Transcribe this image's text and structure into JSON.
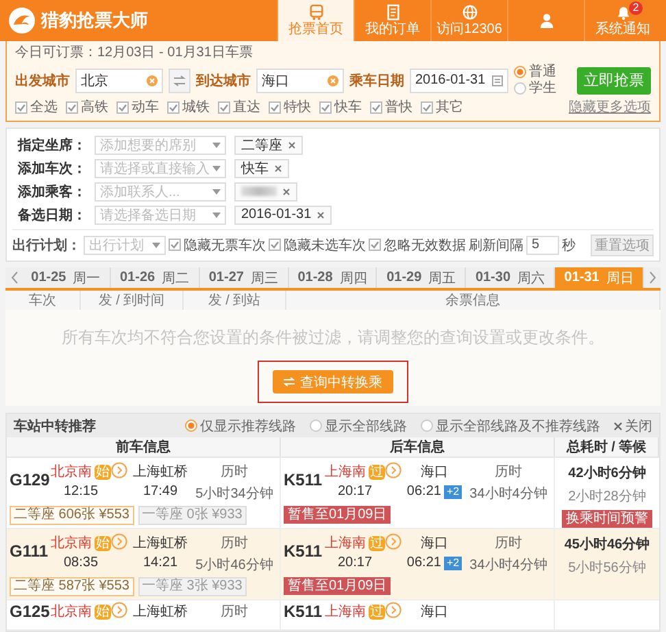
{
  "app": {
    "name": "猎豹抢票大师"
  },
  "nav": [
    {
      "label": "抢票首页",
      "selected": true
    },
    {
      "label": "我的订单",
      "selected": false
    },
    {
      "label": "访问12306",
      "selected": false
    },
    {
      "selected": false
    },
    {
      "label": "系统通知",
      "badge": "2",
      "selected": false
    }
  ],
  "search": {
    "notice": "今日可订票：12月03日 - 01月31日车票",
    "from_label": "出发城市",
    "from": "北京",
    "to_label": "到达城市",
    "to": "海口",
    "date_label": "乘车日期",
    "date": "2016-01-31",
    "ticket_types": [
      {
        "label": "普通",
        "selected": true
      },
      {
        "label": "学生",
        "selected": false
      }
    ],
    "submit": "立即抢票",
    "train_types": [
      {
        "label": "全选",
        "checked": true
      },
      {
        "label": "高铁",
        "checked": true
      },
      {
        "label": "动车",
        "checked": true
      },
      {
        "label": "城铁",
        "checked": true
      },
      {
        "label": "直达",
        "checked": true
      },
      {
        "label": "特快",
        "checked": true
      },
      {
        "label": "快车",
        "checked": true
      },
      {
        "label": "普快",
        "checked": true
      },
      {
        "label": "其它",
        "checked": true
      }
    ],
    "more_link": "隐藏更多选项"
  },
  "filters": [
    {
      "label": "指定坐席：",
      "placeholder": "添加想要的席别",
      "tags": [
        {
          "text": "二等座"
        }
      ]
    },
    {
      "label": "添加车次：",
      "placeholder": "请选择或直接输入",
      "tags": [
        {
          "text": "快车"
        }
      ]
    },
    {
      "label": "添加乘客：",
      "placeholder": "添加联系人...",
      "tags": [
        {
          "redacted": true
        }
      ]
    },
    {
      "label": "备选日期：",
      "placeholder": "请选择备选日期",
      "tags": [
        {
          "text": "2016-01-31"
        }
      ]
    }
  ],
  "plan": {
    "label": "出行计划：",
    "placeholder": "出行计划",
    "options": [
      {
        "label": "隐藏无票车次",
        "checked": true
      },
      {
        "label": "隐藏未选车次",
        "checked": true
      },
      {
        "label": "忽略无效数据",
        "checked": true
      }
    ],
    "interval_label": "刷新间隔",
    "interval": "5",
    "unit": "秒",
    "reset": "重置选项"
  },
  "dates": [
    {
      "date": "01-25",
      "weekday": "周一",
      "selected": false
    },
    {
      "date": "01-26",
      "weekday": "周二",
      "selected": false
    },
    {
      "date": "01-27",
      "weekday": "周三",
      "selected": false
    },
    {
      "date": "01-28",
      "weekday": "周四",
      "selected": false
    },
    {
      "date": "01-29",
      "weekday": "周五",
      "selected": false
    },
    {
      "date": "01-30",
      "weekday": "周六",
      "selected": false
    },
    {
      "date": "01-31",
      "weekday": "周日",
      "selected": true
    }
  ],
  "results": {
    "columns": [
      "车次",
      "发 / 到时间",
      "发 / 到站",
      "余票信息"
    ],
    "empty_message": "所有车次均不符合您设置的条件被过滤，请调整您的查询设置或更改条件。",
    "transfer_button": "查询中转换乘",
    "highlighted": true
  },
  "transfer": {
    "title": "车站中转推荐",
    "modes": [
      {
        "label": "仅显示推荐线路",
        "selected": true
      },
      {
        "label": "显示全部线路",
        "selected": false
      },
      {
        "label": "显示全部线路及不推荐线路",
        "selected": false
      }
    ],
    "close": "关闭",
    "columns": [
      "前车信息",
      "后车信息",
      "总耗时 / 等候"
    ],
    "rows": [
      {
        "selected": false,
        "first": {
          "train": "G129",
          "from": "北京南",
          "from_badge": "始",
          "depart": "12:15",
          "to": "上海虹桥",
          "arrive": "17:49",
          "duration_label": "历时",
          "duration": "5小时34分钟",
          "seats": [
            {
              "text": "二等座 606张 ¥553",
              "selected": true
            },
            {
              "text": "一等座 0张 ¥933",
              "selected": false
            }
          ]
        },
        "second": {
          "train": "K511",
          "from": "上海南",
          "from_badge": "过",
          "depart": "20:17",
          "to": "海口",
          "arrive": "06:21",
          "day_offset": "+2",
          "duration_label": "历时",
          "duration": "34小时4分钟",
          "notice": "暂售至01月09日"
        },
        "total": "42小时6分钟",
        "wait": "2小时28分钟",
        "warning": "换乘时间预警"
      },
      {
        "selected": true,
        "first": {
          "train": "G111",
          "from": "北京南",
          "from_badge": "始",
          "depart": "08:35",
          "to": "上海虹桥",
          "arrive": "14:21",
          "duration_label": "历时",
          "duration": "5小时46分钟",
          "seats": [
            {
              "text": "二等座 587张 ¥553",
              "selected": true
            },
            {
              "text": "一等座 3张 ¥933",
              "selected": false
            }
          ]
        },
        "second": {
          "train": "K511",
          "from": "上海南",
          "from_badge": "过",
          "depart": "20:17",
          "to": "海口",
          "arrive": "06:21",
          "day_offset": "+2",
          "duration_label": "历时",
          "duration": "34小时4分钟",
          "notice": "暂售至01月09日"
        },
        "total": "45小时46分钟",
        "wait": "5小时56分钟"
      },
      {
        "selected": false,
        "first": {
          "train": "G125",
          "from": "北京南",
          "from_badge": "始",
          "to": "上海虹桥",
          "duration_label": "历时"
        },
        "second": {
          "train": "K511",
          "from": "上海南",
          "from_badge": "过",
          "to": "海口"
        }
      }
    ]
  }
}
